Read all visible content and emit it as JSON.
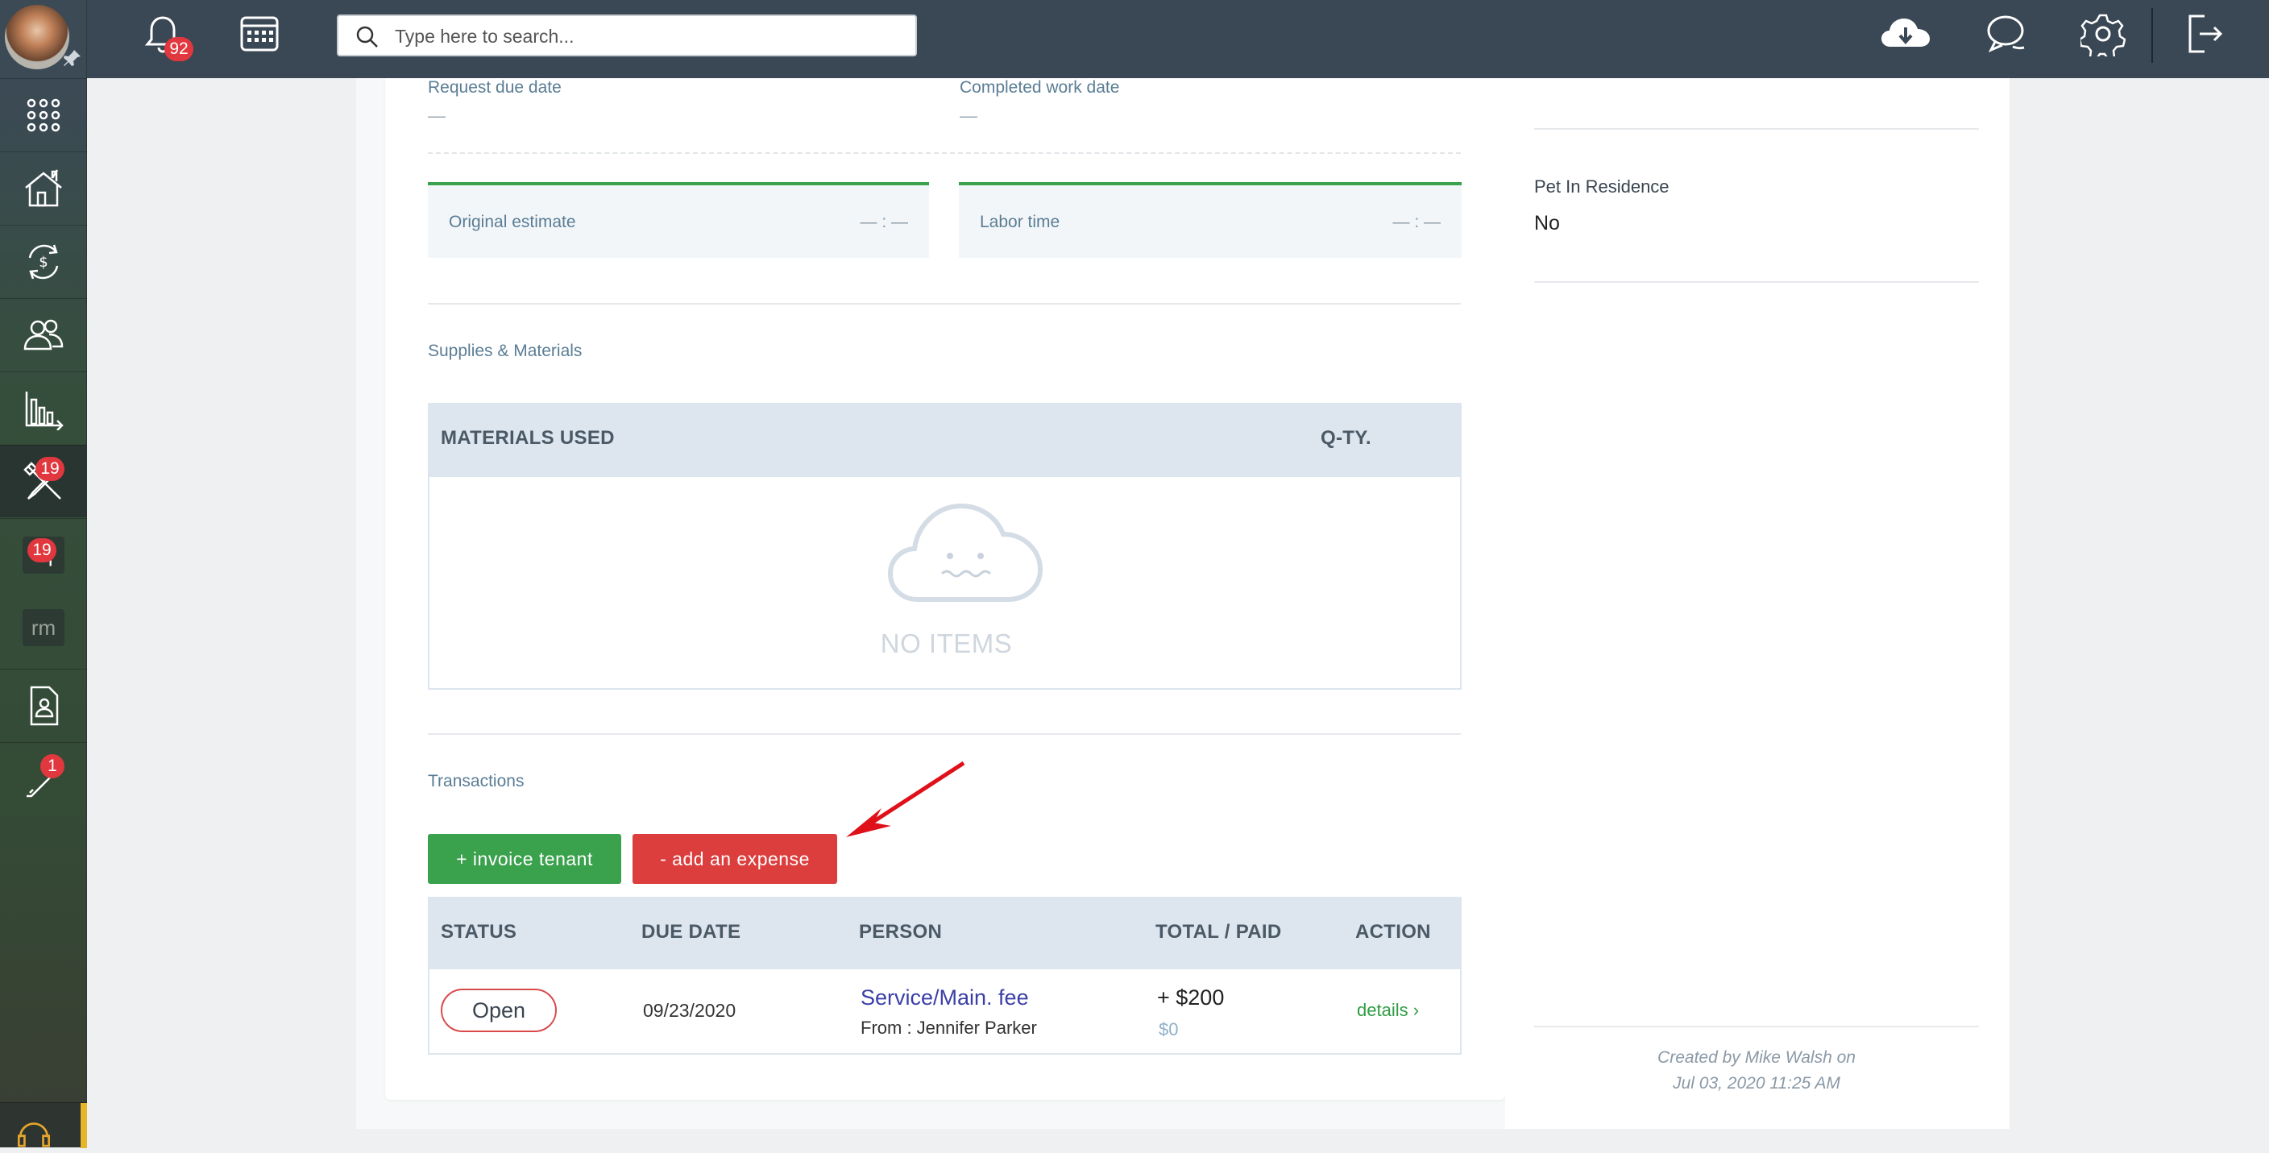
{
  "topbar": {
    "notification_count": "92",
    "search_placeholder": "Type here to search..."
  },
  "sidebar": {
    "maintenance_badge": "19",
    "requests_label": "rq",
    "requests_badge": "19",
    "rm_label": "rm",
    "tools_badge": "1"
  },
  "dates": {
    "request_due_label": "Request due date",
    "request_due_value": "—",
    "completed_label": "Completed work date",
    "completed_value": "—"
  },
  "estimates": {
    "original_label": "Original estimate",
    "original_value": "— : —",
    "labor_label": "Labor time",
    "labor_value": "— : —"
  },
  "supplies": {
    "section_title": "Supplies & Materials",
    "col_materials": "MATERIALS USED",
    "col_qty": "Q-TY.",
    "empty_text": "NO ITEMS"
  },
  "transactions": {
    "section_title": "Transactions",
    "invoice_button": "+ invoice tenant",
    "expense_button": "- add an expense",
    "columns": [
      "STATUS",
      "DUE DATE",
      "PERSON",
      "TOTAL / PAID",
      "ACTION"
    ],
    "rows": [
      {
        "status": "Open",
        "due_date": "09/23/2020",
        "person_title": "Service/Main. fee",
        "person_from": "From : Jennifer Parker",
        "total": "+ $200",
        "paid": "$0",
        "action": "details ›"
      }
    ]
  },
  "right_panel": {
    "pet_label": "Pet In Residence",
    "pet_value": "No",
    "created_line1": "Created by Mike Walsh on",
    "created_line2": "Jul 03, 2020 11:25 AM"
  },
  "colors": {
    "topbar": "#3a4754",
    "green_button": "#3aa14d",
    "red_button": "#dc3d3d",
    "link_blue": "#3b3fa8",
    "annotation_arrow": "#e0101a"
  }
}
